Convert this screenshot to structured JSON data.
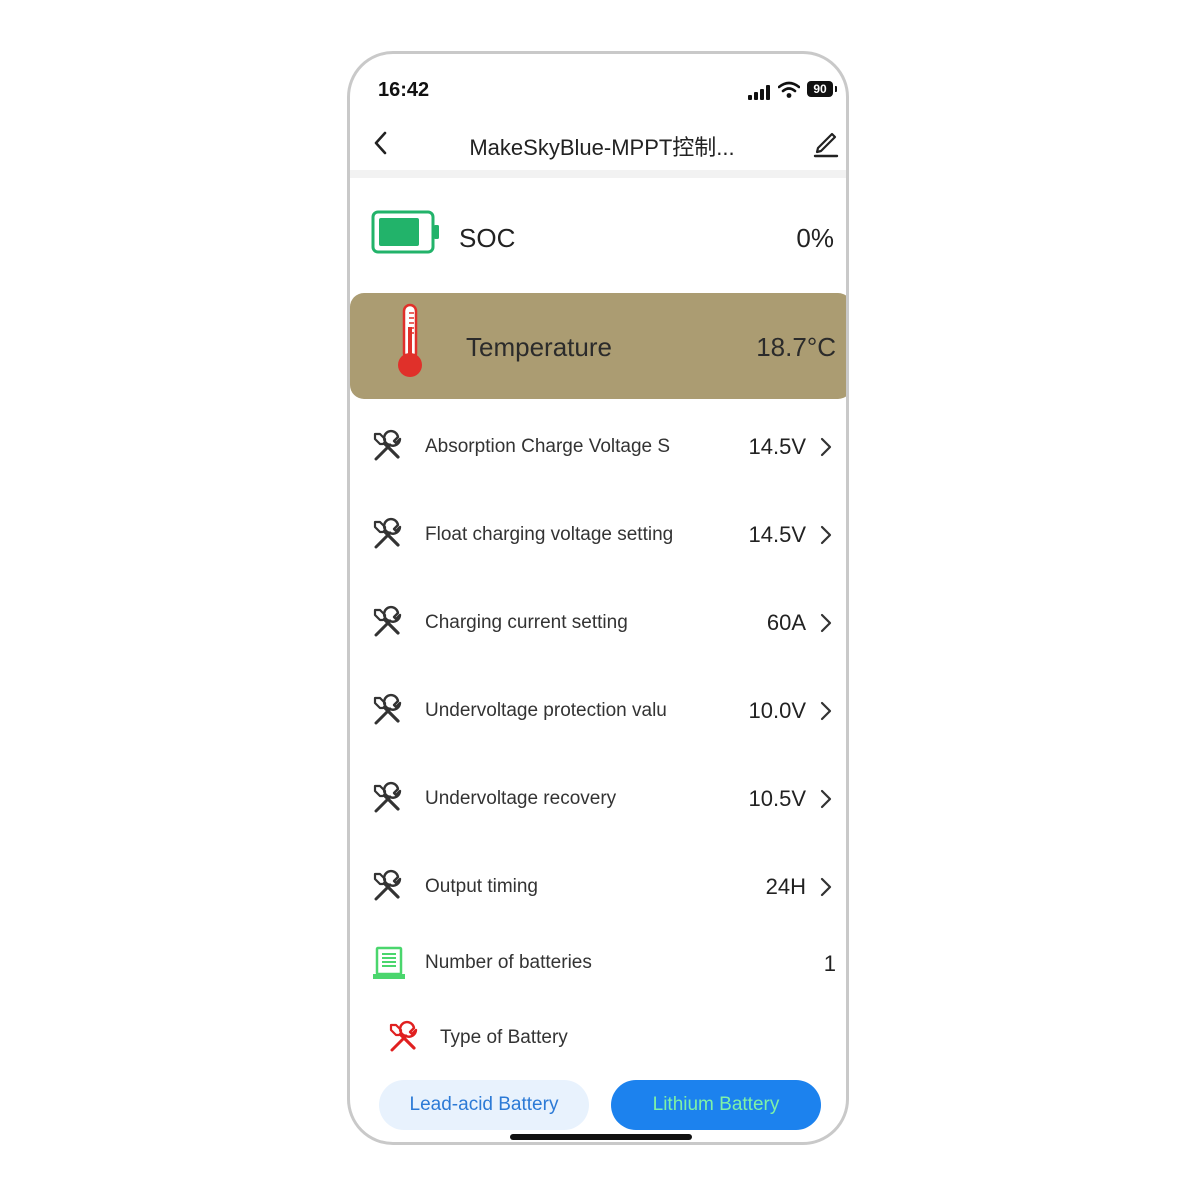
{
  "status_bar": {
    "time": "16:42",
    "battery_level": "90",
    "icons": [
      "signal-icon",
      "wifi-icon",
      "battery-icon"
    ]
  },
  "nav": {
    "title": "MakeSkyBlue-MPPT控制...",
    "back_icon": "back-chevron-icon",
    "edit_icon": "edit-pen-icon"
  },
  "soc": {
    "label": "SOC",
    "value": "0%",
    "icon": "battery-green-icon"
  },
  "temperature": {
    "label": "Temperature",
    "value": "18.7°C",
    "icon": "thermometer-icon"
  },
  "settings": [
    {
      "label": "Absorption Charge Voltage S",
      "value": "14.5V",
      "icon": "tools-icon"
    },
    {
      "label": "Float charging voltage setting",
      "value": "14.5V",
      "icon": "tools-icon"
    },
    {
      "label": "Charging current setting",
      "value": "60A",
      "icon": "tools-icon"
    },
    {
      "label": "Undervoltage protection valu",
      "value": "10.0V",
      "icon": "tools-icon"
    },
    {
      "label": "Undervoltage recovery",
      "value": "10.5V",
      "icon": "tools-icon"
    },
    {
      "label": "Output timing",
      "value": "24H",
      "icon": "tools-icon"
    }
  ],
  "batteries": {
    "label": "Number of batteries",
    "value": "1",
    "icon": "battery-stack-icon"
  },
  "battery_type": {
    "label": "Type of Battery",
    "icon": "tools-red-icon",
    "options": [
      "Lead-acid Battery",
      "Lithium Battery"
    ],
    "selected": "Lithium Battery"
  },
  "colors": {
    "accent_blue": "#1c82ee",
    "temperature_bg": "#ab9c72",
    "battery_green": "#22b36a",
    "selected_text_green": "#7ff2a6"
  }
}
